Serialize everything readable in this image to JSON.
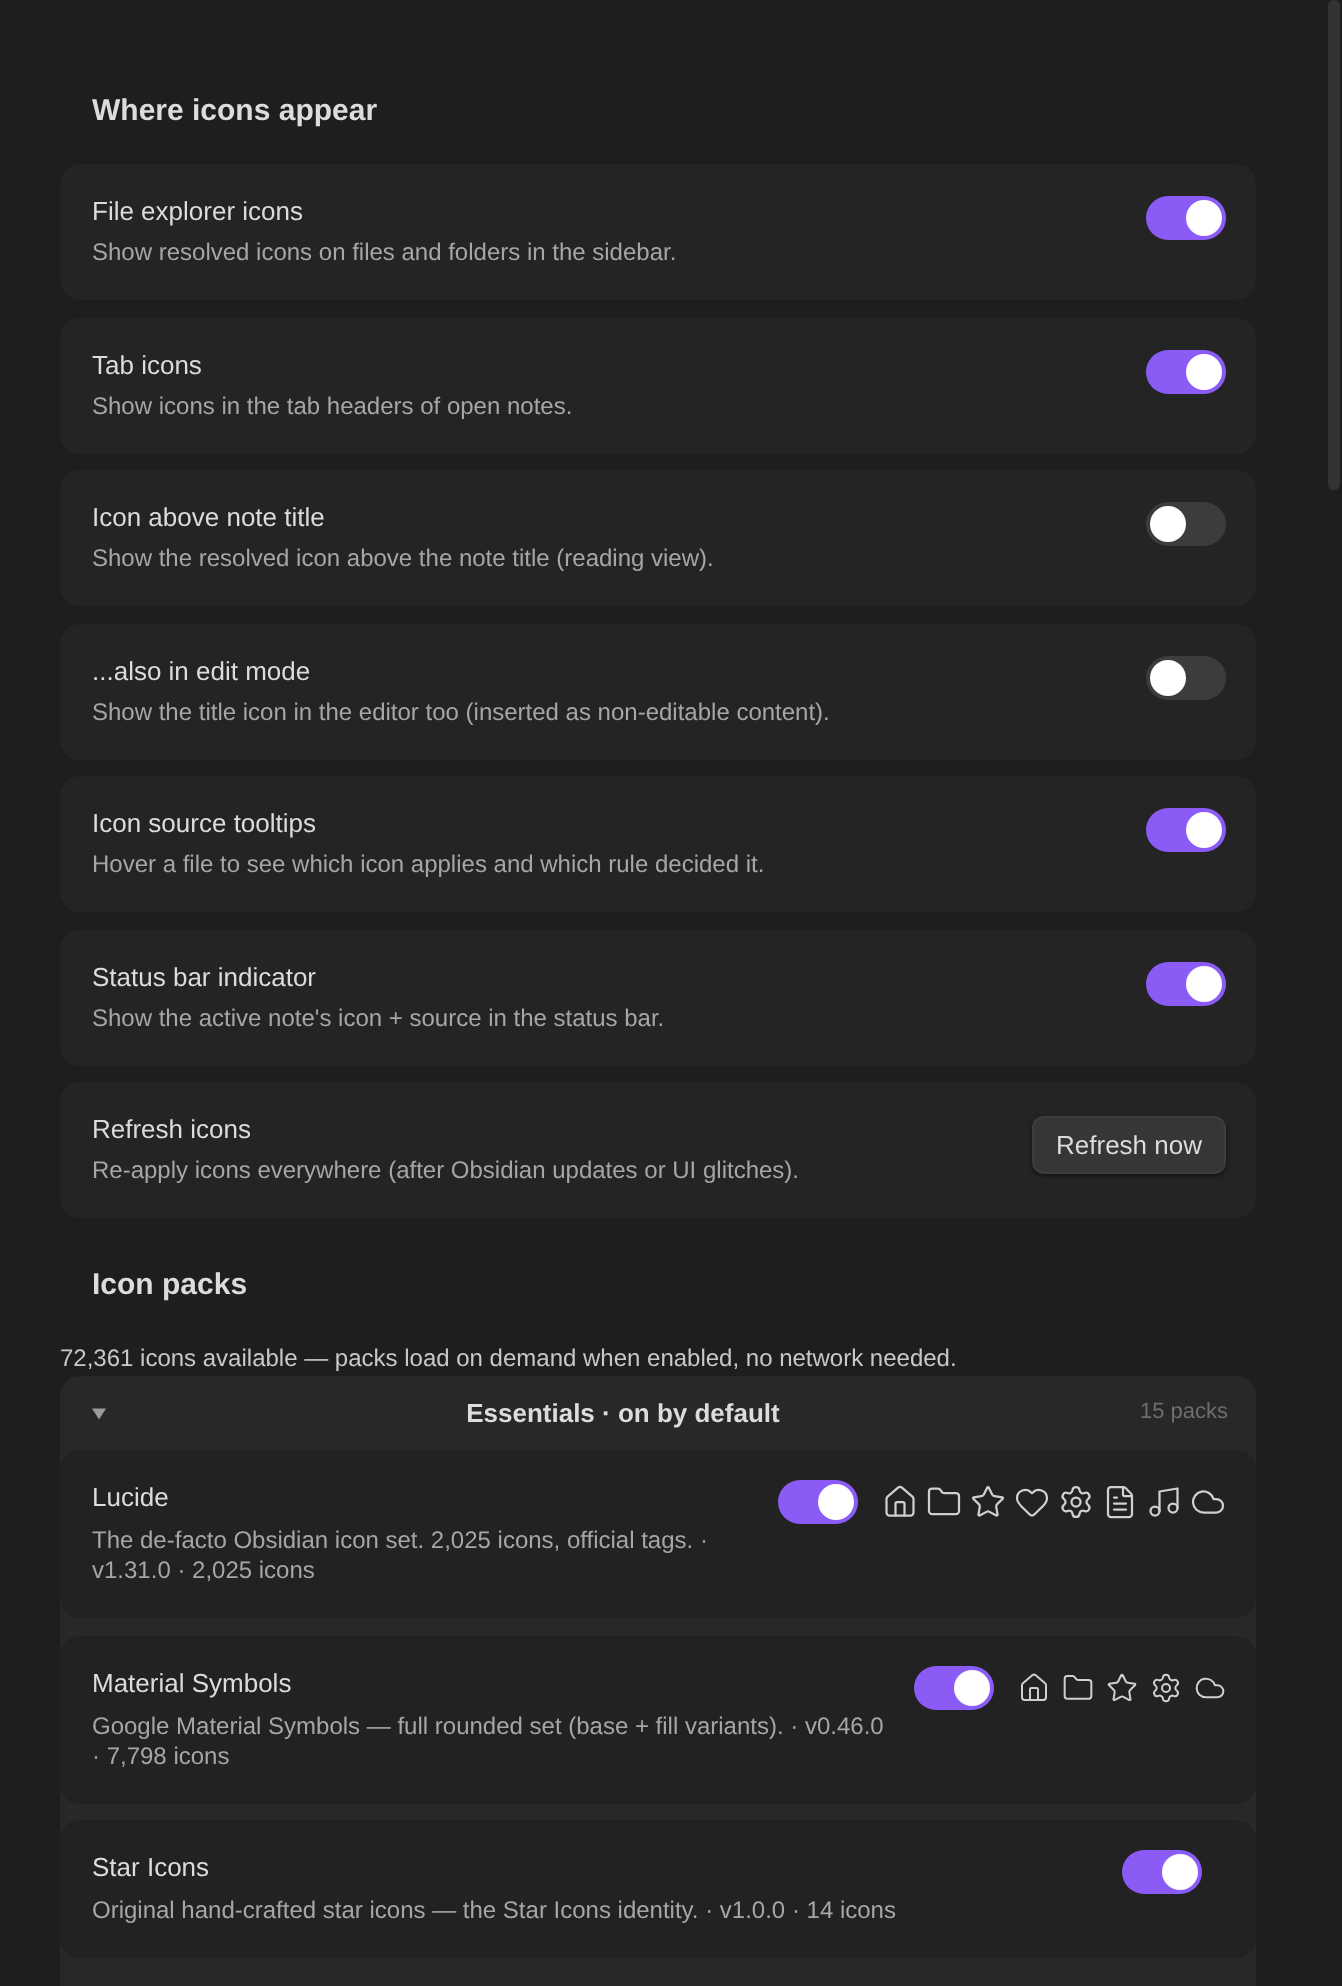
{
  "settings": {
    "heading": "Where icons appear",
    "items": [
      {
        "kind": "toggle",
        "title": "File explorer icons",
        "description": "Show resolved icons on files and folders in the sidebar.",
        "on": true
      },
      {
        "kind": "toggle",
        "title": "Tab icons",
        "description": "Show icons in the tab headers of open notes.",
        "on": true
      },
      {
        "kind": "toggle",
        "title": "Icon above note title",
        "description": "Show the resolved icon above the note title (reading view).",
        "on": false
      },
      {
        "kind": "toggle",
        "title": "...also in edit mode",
        "description": "Show the title icon in the editor too (inserted as non-editable content).",
        "on": false
      },
      {
        "kind": "toggle",
        "title": "Icon source tooltips",
        "description": "Hover a file to see which icon applies and which rule decided it.",
        "on": true
      },
      {
        "kind": "toggle",
        "title": "Status bar indicator",
        "description": "Show the active note's icon + source in the status bar.",
        "on": true
      },
      {
        "kind": "button",
        "title": "Refresh icons",
        "description": "Re-apply icons everywhere (after Obsidian updates or UI glitches).",
        "button": "Refresh now"
      }
    ]
  },
  "icon_packs": {
    "heading": "Icon packs",
    "summary": "72,361 icons available — packs load on demand when enabled, no network needed.",
    "groups": [
      {
        "title": "Essentials · on by default",
        "count": "15 packs",
        "expanded": true,
        "packs": [
          {
            "name": "Lucide",
            "description": "The de-facto Obsidian icon set. 2,025 icons, official tags. · v1.31.0 · 2,025 icons",
            "on": true,
            "kind": "full"
          },
          {
            "name": "Material Symbols",
            "description": "Google Material Symbols — full rounded set (base + fill variants). · v0.46.0 · 7,798 icons",
            "on": true,
            "kind": "short"
          },
          {
            "name": "Star Icons",
            "description": "Original hand-crafted star icons — the Star Icons identity. · v1.0.0 · 14 icons",
            "on": true,
            "kind": "none"
          }
        ]
      }
    ]
  }
}
